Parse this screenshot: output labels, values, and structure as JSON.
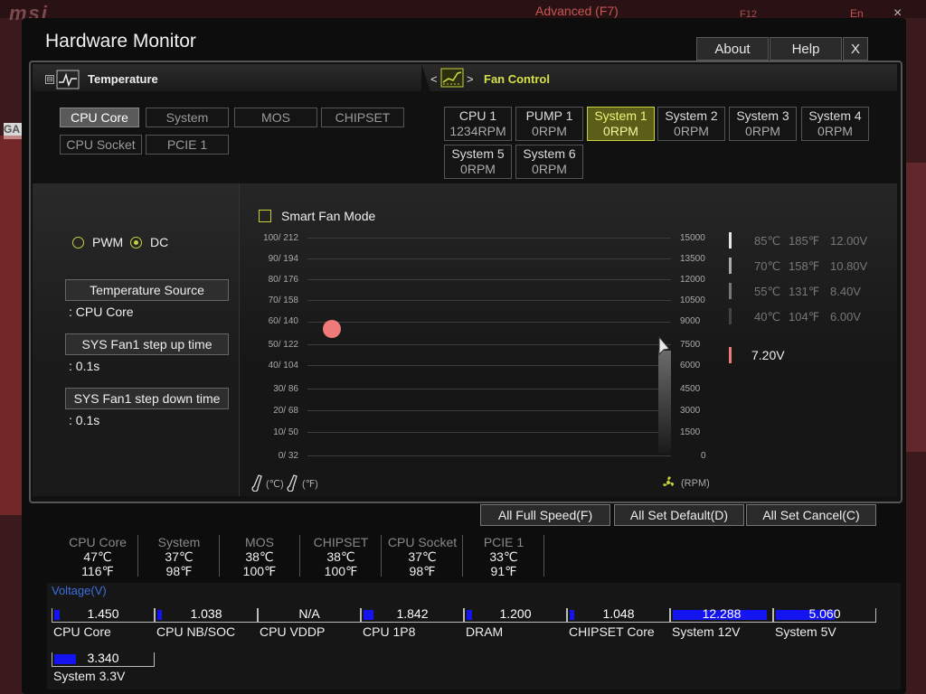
{
  "background": {
    "logo": "msi",
    "advanced": "Advanced (F7)",
    "f12": "F12",
    "lang": "En",
    "close": "×",
    "ga": "GA"
  },
  "window": {
    "title": "Hardware Monitor",
    "about": "About",
    "help": "Help",
    "close": "X"
  },
  "temperature": {
    "title": "Temperature",
    "sources": [
      {
        "label": "CPU Core",
        "active": true
      },
      {
        "label": "System",
        "active": false
      },
      {
        "label": "MOS",
        "active": false
      },
      {
        "label": "CHIPSET",
        "active": false
      },
      {
        "label": "CPU Socket",
        "active": false
      },
      {
        "label": "PCIE 1",
        "active": false
      }
    ]
  },
  "fan_control": {
    "title": "Fan Control",
    "prev": "<",
    "next": ">",
    "fans": [
      {
        "name": "CPU 1",
        "rpm": "1234RPM",
        "active": false
      },
      {
        "name": "PUMP 1",
        "rpm": "0RPM",
        "active": false
      },
      {
        "name": "System 1",
        "rpm": "0RPM",
        "active": true
      },
      {
        "name": "System 2",
        "rpm": "0RPM",
        "active": false
      },
      {
        "name": "System 3",
        "rpm": "0RPM",
        "active": false
      },
      {
        "name": "System 4",
        "rpm": "0RPM",
        "active": false
      },
      {
        "name": "System 5",
        "rpm": "0RPM",
        "active": false
      },
      {
        "name": "System 6",
        "rpm": "0RPM",
        "active": false
      }
    ]
  },
  "mode": {
    "pwm": "PWM",
    "dc": "DC",
    "selected": "DC",
    "smart_fan": "Smart Fan Mode",
    "smart_fan_checked": false
  },
  "settings": {
    "temp_source_label": "Temperature Source",
    "temp_source_value": ": CPU Core",
    "step_up_label": "SYS Fan1 step up time",
    "step_up_value": ": 0.1s",
    "step_down_label": "SYS Fan1 step down time",
    "step_down_value": ": 0.1s"
  },
  "graph": {
    "left_ticks": [
      "100/ 212",
      "90/ 194",
      "80/ 176",
      "70/ 158",
      "60/ 140",
      "50/ 122",
      "40/ 104",
      "30/  86",
      "20/  68",
      "10/  50",
      "0/  32"
    ],
    "right_ticks": [
      "15000",
      "13500",
      "12000",
      "10500",
      "9000",
      "7500",
      "6000",
      "4500",
      "3000",
      "1500",
      "0"
    ],
    "celsius_unit": "(℃)",
    "fahrenheit_unit": "(℉)",
    "rpm_unit": "(RPM)",
    "point_temp_c": 58,
    "point_color": "#f07a7a"
  },
  "voltage_legend": {
    "rows": [
      {
        "c": "85℃",
        "f": "185℉",
        "v": "12.00V"
      },
      {
        "c": "70℃",
        "f": "158℉",
        "v": "10.80V"
      },
      {
        "c": "55℃",
        "f": "131℉",
        "v": "8.40V"
      },
      {
        "c": "40℃",
        "f": "104℉",
        "v": "6.00V"
      }
    ],
    "current": "7.20V"
  },
  "actions": {
    "full_speed": "All Full Speed(F)",
    "set_default": "All Set Default(D)",
    "set_cancel": "All Set Cancel(C)"
  },
  "monitors": [
    {
      "name": "CPU Core",
      "c": "47℃",
      "f": "116℉"
    },
    {
      "name": "System",
      "c": "37℃",
      "f": "98℉"
    },
    {
      "name": "MOS",
      "c": "38℃",
      "f": "100℉"
    },
    {
      "name": "CHIPSET",
      "c": "38℃",
      "f": "100℉"
    },
    {
      "name": "CPU Socket",
      "c": "37℃",
      "f": "98℉"
    },
    {
      "name": "PCIE 1",
      "c": "33℃",
      "f": "91℉"
    }
  ],
  "voltage": {
    "title": "Voltage(V)",
    "items": [
      {
        "name": "CPU Core",
        "value": "1.450",
        "level": 0.06
      },
      {
        "name": "CPU NB/SOC",
        "value": "1.038",
        "level": 0.05
      },
      {
        "name": "CPU VDDP",
        "value": "N/A",
        "level": 0
      },
      {
        "name": "CPU 1P8",
        "value": "1.842",
        "level": 0.1
      },
      {
        "name": "DRAM",
        "value": "1.200",
        "level": 0.06
      },
      {
        "name": "CHIPSET Core",
        "value": "1.048",
        "level": 0.05
      },
      {
        "name": "System 12V",
        "value": "12.288",
        "level": 0.96
      },
      {
        "name": "System 5V",
        "value": "5.060",
        "level": 0.6
      },
      {
        "name": "System 3.3V",
        "value": "3.340",
        "level": 0.22
      }
    ]
  }
}
